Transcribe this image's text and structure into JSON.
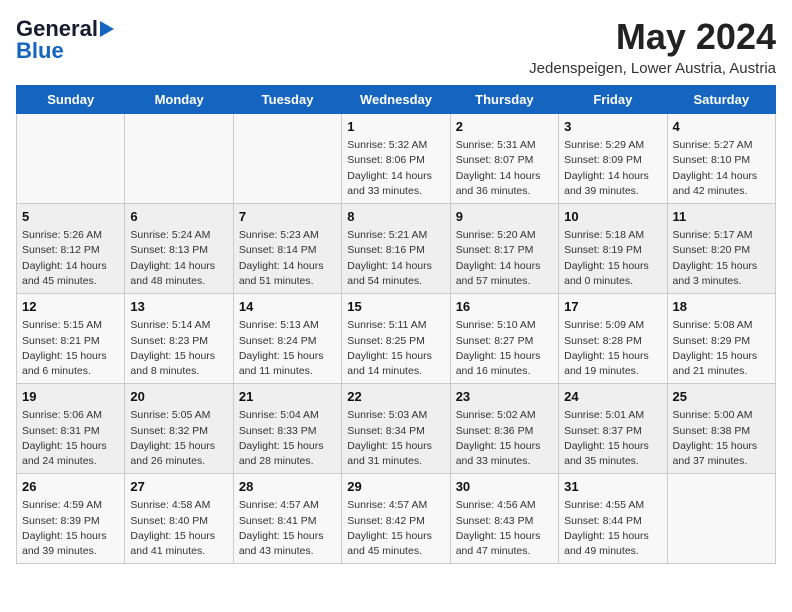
{
  "header": {
    "logo_general": "General",
    "logo_blue": "Blue",
    "month_year": "May 2024",
    "location": "Jedenspeigen, Lower Austria, Austria"
  },
  "days_of_week": [
    "Sunday",
    "Monday",
    "Tuesday",
    "Wednesday",
    "Thursday",
    "Friday",
    "Saturday"
  ],
  "weeks": [
    [
      {
        "day": "",
        "info": ""
      },
      {
        "day": "",
        "info": ""
      },
      {
        "day": "",
        "info": ""
      },
      {
        "day": "1",
        "info": "Sunrise: 5:32 AM\nSunset: 8:06 PM\nDaylight: 14 hours\nand 33 minutes."
      },
      {
        "day": "2",
        "info": "Sunrise: 5:31 AM\nSunset: 8:07 PM\nDaylight: 14 hours\nand 36 minutes."
      },
      {
        "day": "3",
        "info": "Sunrise: 5:29 AM\nSunset: 8:09 PM\nDaylight: 14 hours\nand 39 minutes."
      },
      {
        "day": "4",
        "info": "Sunrise: 5:27 AM\nSunset: 8:10 PM\nDaylight: 14 hours\nand 42 minutes."
      }
    ],
    [
      {
        "day": "5",
        "info": "Sunrise: 5:26 AM\nSunset: 8:12 PM\nDaylight: 14 hours\nand 45 minutes."
      },
      {
        "day": "6",
        "info": "Sunrise: 5:24 AM\nSunset: 8:13 PM\nDaylight: 14 hours\nand 48 minutes."
      },
      {
        "day": "7",
        "info": "Sunrise: 5:23 AM\nSunset: 8:14 PM\nDaylight: 14 hours\nand 51 minutes."
      },
      {
        "day": "8",
        "info": "Sunrise: 5:21 AM\nSunset: 8:16 PM\nDaylight: 14 hours\nand 54 minutes."
      },
      {
        "day": "9",
        "info": "Sunrise: 5:20 AM\nSunset: 8:17 PM\nDaylight: 14 hours\nand 57 minutes."
      },
      {
        "day": "10",
        "info": "Sunrise: 5:18 AM\nSunset: 8:19 PM\nDaylight: 15 hours\nand 0 minutes."
      },
      {
        "day": "11",
        "info": "Sunrise: 5:17 AM\nSunset: 8:20 PM\nDaylight: 15 hours\nand 3 minutes."
      }
    ],
    [
      {
        "day": "12",
        "info": "Sunrise: 5:15 AM\nSunset: 8:21 PM\nDaylight: 15 hours\nand 6 minutes."
      },
      {
        "day": "13",
        "info": "Sunrise: 5:14 AM\nSunset: 8:23 PM\nDaylight: 15 hours\nand 8 minutes."
      },
      {
        "day": "14",
        "info": "Sunrise: 5:13 AM\nSunset: 8:24 PM\nDaylight: 15 hours\nand 11 minutes."
      },
      {
        "day": "15",
        "info": "Sunrise: 5:11 AM\nSunset: 8:25 PM\nDaylight: 15 hours\nand 14 minutes."
      },
      {
        "day": "16",
        "info": "Sunrise: 5:10 AM\nSunset: 8:27 PM\nDaylight: 15 hours\nand 16 minutes."
      },
      {
        "day": "17",
        "info": "Sunrise: 5:09 AM\nSunset: 8:28 PM\nDaylight: 15 hours\nand 19 minutes."
      },
      {
        "day": "18",
        "info": "Sunrise: 5:08 AM\nSunset: 8:29 PM\nDaylight: 15 hours\nand 21 minutes."
      }
    ],
    [
      {
        "day": "19",
        "info": "Sunrise: 5:06 AM\nSunset: 8:31 PM\nDaylight: 15 hours\nand 24 minutes."
      },
      {
        "day": "20",
        "info": "Sunrise: 5:05 AM\nSunset: 8:32 PM\nDaylight: 15 hours\nand 26 minutes."
      },
      {
        "day": "21",
        "info": "Sunrise: 5:04 AM\nSunset: 8:33 PM\nDaylight: 15 hours\nand 28 minutes."
      },
      {
        "day": "22",
        "info": "Sunrise: 5:03 AM\nSunset: 8:34 PM\nDaylight: 15 hours\nand 31 minutes."
      },
      {
        "day": "23",
        "info": "Sunrise: 5:02 AM\nSunset: 8:36 PM\nDaylight: 15 hours\nand 33 minutes."
      },
      {
        "day": "24",
        "info": "Sunrise: 5:01 AM\nSunset: 8:37 PM\nDaylight: 15 hours\nand 35 minutes."
      },
      {
        "day": "25",
        "info": "Sunrise: 5:00 AM\nSunset: 8:38 PM\nDaylight: 15 hours\nand 37 minutes."
      }
    ],
    [
      {
        "day": "26",
        "info": "Sunrise: 4:59 AM\nSunset: 8:39 PM\nDaylight: 15 hours\nand 39 minutes."
      },
      {
        "day": "27",
        "info": "Sunrise: 4:58 AM\nSunset: 8:40 PM\nDaylight: 15 hours\nand 41 minutes."
      },
      {
        "day": "28",
        "info": "Sunrise: 4:57 AM\nSunset: 8:41 PM\nDaylight: 15 hours\nand 43 minutes."
      },
      {
        "day": "29",
        "info": "Sunrise: 4:57 AM\nSunset: 8:42 PM\nDaylight: 15 hours\nand 45 minutes."
      },
      {
        "day": "30",
        "info": "Sunrise: 4:56 AM\nSunset: 8:43 PM\nDaylight: 15 hours\nand 47 minutes."
      },
      {
        "day": "31",
        "info": "Sunrise: 4:55 AM\nSunset: 8:44 PM\nDaylight: 15 hours\nand 49 minutes."
      },
      {
        "day": "",
        "info": ""
      }
    ]
  ]
}
